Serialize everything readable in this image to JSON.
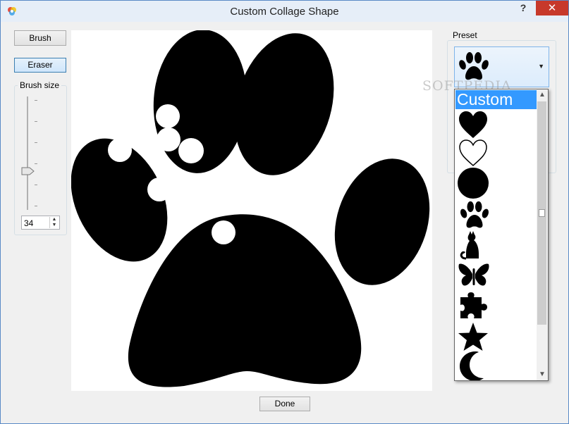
{
  "window": {
    "title": "Custom Collage Shape",
    "help_label": "?",
    "close_label": "✕"
  },
  "tools": {
    "brush_label": "Brush",
    "eraser_label": "Eraser",
    "selected": "Eraser"
  },
  "brush_size": {
    "label": "Brush size",
    "value": "34"
  },
  "preset": {
    "label": "Preset",
    "selected_icon": "paw-icon",
    "options": [
      {
        "label": "Custom",
        "icon": null,
        "highlighted": true
      },
      {
        "label": "",
        "icon": "heart-filled-icon"
      },
      {
        "label": "",
        "icon": "heart-outline-icon"
      },
      {
        "label": "",
        "icon": "circle-icon"
      },
      {
        "label": "",
        "icon": "paw-icon"
      },
      {
        "label": "",
        "icon": "cat-icon"
      },
      {
        "label": "",
        "icon": "butterfly-icon"
      },
      {
        "label": "",
        "icon": "puzzle-piece-icon"
      },
      {
        "label": "",
        "icon": "star-icon"
      },
      {
        "label": "",
        "icon": "crescent-moon-icon"
      }
    ]
  },
  "watermark": "SOFTPEDIA",
  "footer": {
    "done_label": "Done"
  },
  "colors": {
    "accent": "#3399ff",
    "close_red": "#c7392b",
    "shape": "#000000"
  }
}
